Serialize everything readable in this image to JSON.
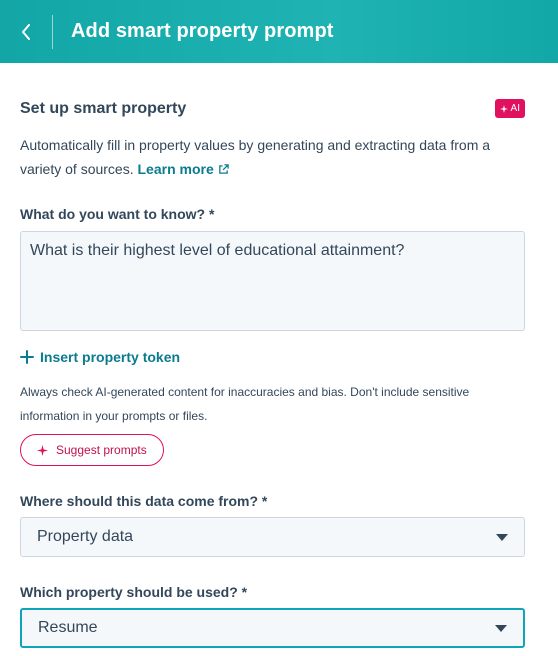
{
  "header": {
    "title": "Add smart property prompt"
  },
  "section": {
    "title": "Set up smart property",
    "ai_badge": "AI",
    "description": "Automatically fill in property values by generating and extracting data from a variety of sources.",
    "learn_more": "Learn more"
  },
  "question": {
    "label": "What do you want to know? *",
    "value": "What is their highest level of educational attainment?"
  },
  "insert_token": {
    "label": "Insert property token"
  },
  "disclaimer": "Always check AI-generated content for inaccuracies and bias. Don't include sensitive information in your prompts or files.",
  "suggest": {
    "label": "Suggest prompts"
  },
  "source": {
    "label": "Where should this data come from? *",
    "selected": "Property data"
  },
  "property": {
    "label": "Which property should be used? *",
    "selected": "Resume"
  },
  "colors": {
    "header_bg": "#13a6a6",
    "link": "#0b7b90",
    "ai_accent": "#e0115f",
    "focus_border": "#0fa4b8"
  }
}
